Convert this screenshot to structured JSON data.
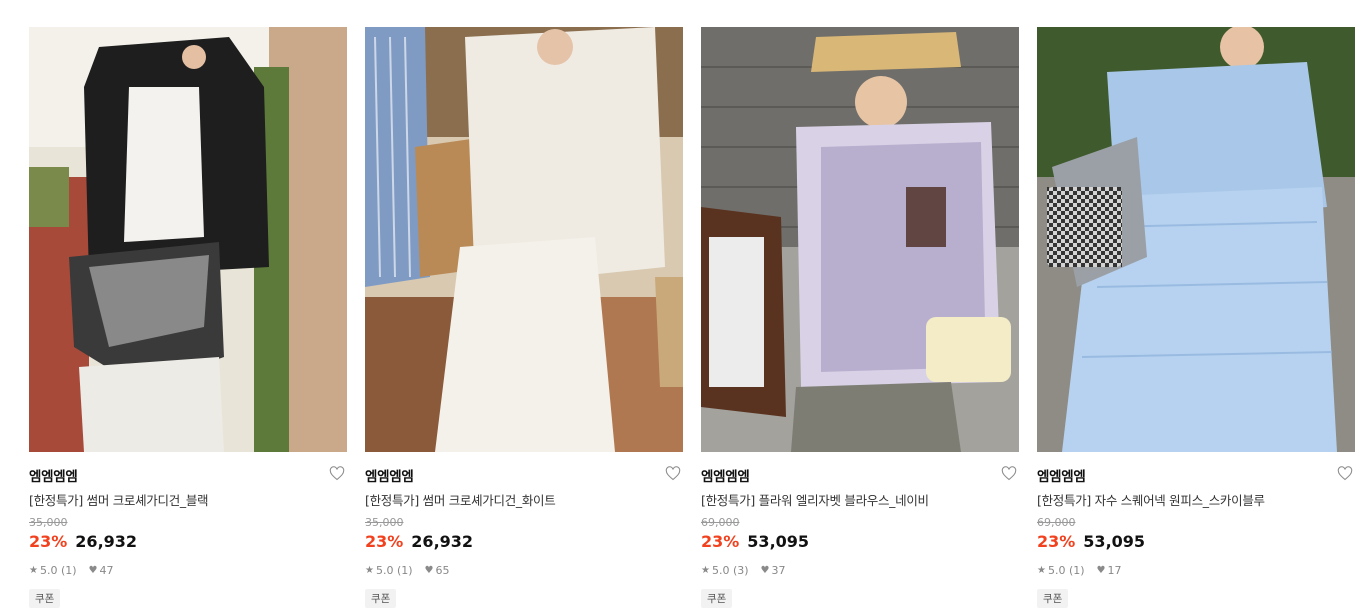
{
  "products": [
    {
      "brand": "엠엠엠엠",
      "title": "[한정특가] 썸머 크로셰가디건_블랙",
      "original_price": "35,000",
      "discount": "23%",
      "price": "26,932",
      "rating": "5.0 (1)",
      "likes": "47",
      "coupon": "쿠폰"
    },
    {
      "brand": "엠엠엠엠",
      "title": "[한정특가] 썸머 크로셰가디건_화이트",
      "original_price": "35,000",
      "discount": "23%",
      "price": "26,932",
      "rating": "5.0 (1)",
      "likes": "65",
      "coupon": "쿠폰"
    },
    {
      "brand": "엠엠엠엠",
      "title": "[한정특가] 플라워 엘리자벳 블라우스_네이비",
      "original_price": "69,000",
      "discount": "23%",
      "price": "53,095",
      "rating": "5.0 (3)",
      "likes": "37",
      "coupon": "쿠폰"
    },
    {
      "brand": "엠엠엠엠",
      "title": "[한정특가] 자수 스퀘어넥 원피스_스카이블루",
      "original_price": "69,000",
      "discount": "23%",
      "price": "53,095",
      "rating": "5.0 (1)",
      "likes": "17",
      "coupon": "쿠폰"
    }
  ],
  "colors": {
    "discount": "#f1411f",
    "price": "#111111",
    "muted": "#999999"
  },
  "icons": {
    "wishlist": "heart-outline-icon",
    "rating": "star-icon",
    "likes": "heart-filled-icon"
  }
}
